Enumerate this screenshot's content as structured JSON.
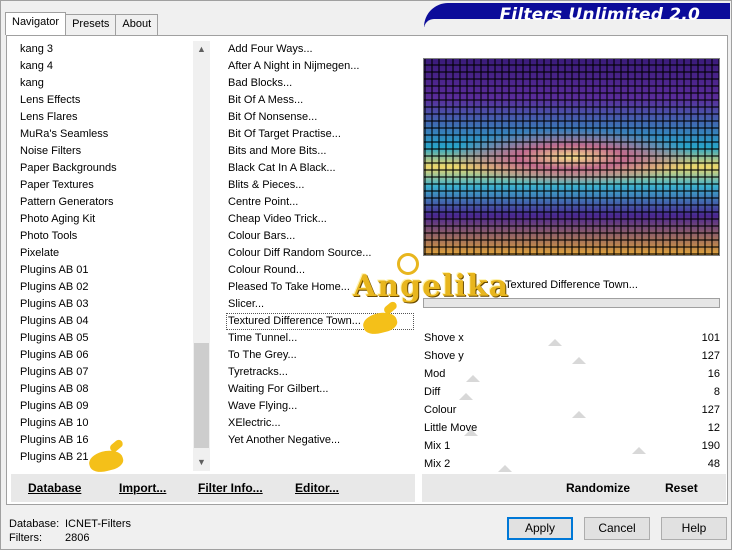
{
  "window": {
    "banner_title": "Filters Unlimited 2.0",
    "tabs": [
      {
        "label": "Navigator",
        "active": true
      },
      {
        "label": "Presets",
        "active": false
      },
      {
        "label": "About",
        "active": false
      }
    ]
  },
  "categories": {
    "items": [
      "kang 3",
      "kang 4",
      "kang",
      "Lens Effects",
      "Lens Flares",
      "MuRa's Seamless",
      "Noise Filters",
      "Paper Backgrounds",
      "Paper Textures",
      "Pattern Generators",
      "Photo Aging Kit",
      "Photo Tools",
      "Pixelate",
      "Plugins AB 01",
      "Plugins AB 02",
      "Plugins AB 03",
      "Plugins AB 04",
      "Plugins AB 05",
      "Plugins AB 06",
      "Plugins AB 07",
      "Plugins AB 08",
      "Plugins AB 09",
      "Plugins AB 10",
      "Plugins AB 16",
      "Plugins AB 21"
    ],
    "selected": "Plugins AB 21"
  },
  "filters": {
    "items": [
      "Add Four Ways...",
      "After A Night in Nijmegen...",
      "Bad Blocks...",
      "Bit Of A Mess...",
      "Bit Of Nonsense...",
      "Bit Of Target Practise...",
      "Bits and More Bits...",
      "Black Cat In A Black...",
      "Blits & Pieces...",
      "Centre Point...",
      "Cheap Video Trick...",
      "Colour Bars...",
      "Colour Diff Random Source...",
      "Colour Round...",
      "Pleased To Take Home...",
      "Slicer...",
      "Textured Difference Town...",
      "Time Tunnel...",
      "To The Grey...",
      "Tyretracks...",
      "Waiting For Gilbert...",
      "Wave Flying...",
      "XElectric...",
      "Yet Another Negative..."
    ],
    "selected": "Textured Difference Town..."
  },
  "preview": {
    "filter_name": "Textured Difference Town...",
    "colors": {
      "accent": "#0c0c9a",
      "watermark": "#e8b61e"
    }
  },
  "sliders": [
    {
      "label": "Shove x",
      "value": "101",
      "level": 0.4
    },
    {
      "label": "Shove y",
      "value": "127",
      "level": 0.5
    },
    {
      "label": "Mod",
      "value": "16",
      "level": 0.06
    },
    {
      "label": "Diff",
      "value": "8",
      "level": 0.03
    },
    {
      "label": "Colour",
      "value": "127",
      "level": 0.5
    },
    {
      "label": "Little Move",
      "value": "12",
      "level": 0.05
    },
    {
      "label": "Mix 1",
      "value": "190",
      "level": 0.75
    },
    {
      "label": "Mix 2",
      "value": "48",
      "level": 0.19
    }
  ],
  "left_buttons": {
    "database": "Database",
    "import": "Import...",
    "filter_info": "Filter Info...",
    "editor": "Editor..."
  },
  "right_buttons": {
    "randomize": "Randomize",
    "reset": "Reset"
  },
  "status": {
    "database_label": "Database:",
    "database_value": "ICNET-Filters",
    "filters_label": "Filters:",
    "filters_value": "2806"
  },
  "dialog_buttons": {
    "apply": "Apply",
    "cancel": "Cancel",
    "help": "Help"
  },
  "watermark": {
    "text": "Angelika"
  }
}
